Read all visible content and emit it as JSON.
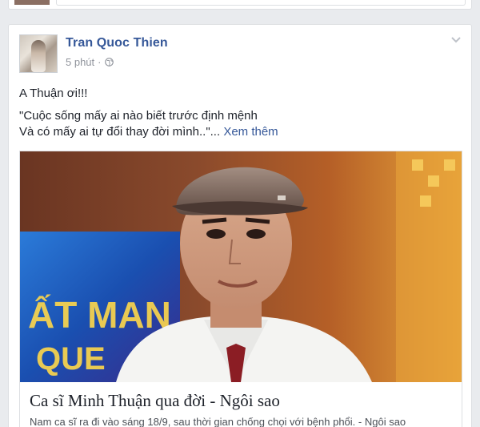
{
  "post": {
    "author": "Tran Quoc Thien",
    "time": "5 phút",
    "separator": "·",
    "audience_icon": "globe-icon",
    "menu_icon": "chevron-down-icon",
    "text_line1": "A Thuận ơi!!!",
    "text_line2": "\"Cuộc sống mấy ai nào biết trước định mệnh",
    "text_line3": "Và có mấy ai tự đổi thay đời mình..\"...",
    "see_more": "Xem thêm"
  },
  "link": {
    "title": "Ca sĩ Minh Thuận qua đời - Ngôi sao",
    "description": "Nam ca sĩ ra đi vào sáng 18/9, sau thời gian chống chọi với bệnh phổi. - Ngôi sao",
    "image_subject": "man-in-cap-portrait"
  },
  "colors": {
    "link_blue": "#365899",
    "meta_gray": "#90949c",
    "text": "#1d2129",
    "background": "#e9ebee"
  }
}
